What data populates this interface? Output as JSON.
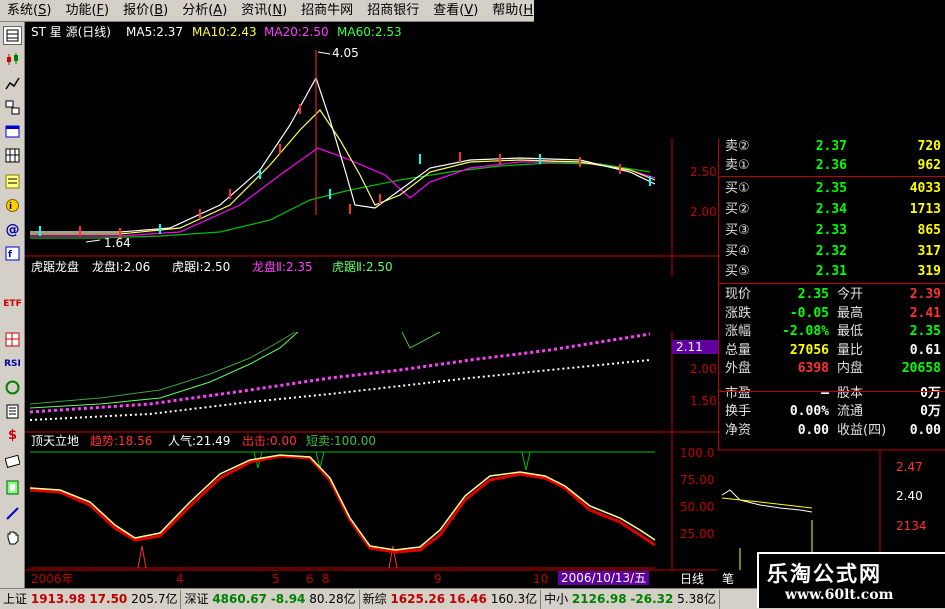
{
  "menu": [
    "系统",
    "功能",
    "报价",
    "分析",
    "资讯",
    "招商牛网",
    "招商银行",
    "查看",
    "帮助"
  ],
  "menu_keys": [
    "S",
    "F",
    "B",
    "A",
    "N",
    "",
    "",
    "V",
    "H"
  ],
  "toolbar_icons": [
    "quote-icon",
    "kline-icon",
    "trend-icon",
    "multi-window-icon",
    "window-icon",
    "grid-icon",
    "f10-icon",
    "news-icon",
    "at-icon",
    "info-icon",
    "etf-icon",
    "ma-icon",
    "rsi-icon",
    "refresh-icon",
    "list-icon",
    "money-icon",
    "note-icon",
    "exit-icon",
    "pen-icon",
    "hand-icon"
  ],
  "toolbar_labels": {
    "etf": "ETF",
    "rsi": "RSI",
    "money": "$"
  },
  "main": {
    "stock_name": "ST 星 源(日线)",
    "ma5": "MA5:2.37",
    "ma10": "MA10:2.43",
    "ma20": "MA20:2.50",
    "ma60": "MA60:2.53",
    "high_label": "4.05",
    "low_label": "1.64",
    "axis": [
      "2.50",
      "2.00"
    ]
  },
  "indicator1": {
    "title": "虎踞龙盘",
    "longpan1": "龙盘Ⅰ:2.06",
    "huju1": "虎踞Ⅰ:2.50",
    "longpan2": "龙盘Ⅱ:2.35",
    "huju2": "虎踞Ⅱ:2.50",
    "axis_hl": "2.11",
    "axis": [
      "2.00",
      "1.50"
    ]
  },
  "indicator2": {
    "title": "顶天立地",
    "trend": "趋势:18.56",
    "popularity": "人气:21.49",
    "exit": "出击:0.00",
    "short": "短卖:100.00",
    "axis": [
      "100.0",
      "75.00",
      "50.00",
      "25.00"
    ]
  },
  "timeline": {
    "year": "2006年",
    "ticks": [
      "4",
      "5",
      "6",
      "8",
      "9",
      "10"
    ],
    "date": "2006/10/13/五",
    "period": "日线"
  },
  "quote": {
    "asks": [
      {
        "label": "卖②",
        "price": "2.37",
        "vol": "720"
      },
      {
        "label": "卖①",
        "price": "2.36",
        "vol": "962"
      }
    ],
    "bids": [
      {
        "label": "买①",
        "price": "2.35",
        "vol": "4033"
      },
      {
        "label": "买②",
        "price": "2.34",
        "vol": "1713"
      },
      {
        "label": "买③",
        "price": "2.33",
        "vol": "865"
      },
      {
        "label": "买④",
        "price": "2.32",
        "vol": "317"
      },
      {
        "label": "买⑤",
        "price": "2.31",
        "vol": "319"
      }
    ],
    "stats": [
      {
        "l1": "现价",
        "v1": "2.35",
        "c1": "#00ff00",
        "l2": "今开",
        "v2": "2.39",
        "c2": "#ff3030"
      },
      {
        "l1": "涨跌",
        "v1": "-0.05",
        "c1": "#00ff00",
        "l2": "最高",
        "v2": "2.41",
        "c2": "#ff3030"
      },
      {
        "l1": "涨幅",
        "v1": "-2.08%",
        "c1": "#00ff00",
        "l2": "最低",
        "v2": "2.35",
        "c2": "#00ff00"
      },
      {
        "l1": "总量",
        "v1": "27056",
        "c1": "#ffff00",
        "l2": "量比",
        "v2": "0.61",
        "c2": "#ffffff"
      },
      {
        "l1": "外盘",
        "v1": "6398",
        "c1": "#ff3030",
        "l2": "内盘",
        "v2": "20658",
        "c2": "#00ff00"
      },
      {
        "l1": "市盈",
        "v1": "—",
        "c1": "#ffffff",
        "l2": "股本",
        "v2": "0万",
        "c2": "#ffffff"
      },
      {
        "l1": "换手",
        "v1": "0.00%",
        "c1": "#ffffff",
        "l2": "流通",
        "v2": "0万",
        "c2": "#ffffff"
      },
      {
        "l1": "净资",
        "v1": "0.00",
        "c1": "#ffffff",
        "l2": "收益(四)",
        "v2": "0.00",
        "c2": "#ffffff"
      }
    ]
  },
  "mini": {
    "axis": [
      "2.47",
      "2.40",
      "2134"
    ],
    "tab": "笔"
  },
  "statusbar": {
    "sh_label": "上证",
    "sh_index": "1913.98",
    "sh_change": "17.50",
    "sh_amount": "205.7亿",
    "sz_label": "深证",
    "sz_index": "4860.67",
    "sz_change": "-8.94",
    "sz_amount": "80.28亿",
    "nf_label": "新综",
    "nf_index": "1625.26",
    "nf_change": "16.46",
    "nf_amount": "160.3亿",
    "sme_label": "中小",
    "sme_index": "2126.98",
    "sme_change": "-26.32",
    "sme_amount": "5.38亿"
  },
  "watermark": {
    "title": "乐淘公式网",
    "url": "www.60lt.com"
  },
  "colors": {
    "up": "#ff3030",
    "down": "#00ff00",
    "ma5": "#ffffff",
    "ma10": "#ffff00",
    "ma20": "#ff00ff",
    "ma60": "#00ff00"
  }
}
